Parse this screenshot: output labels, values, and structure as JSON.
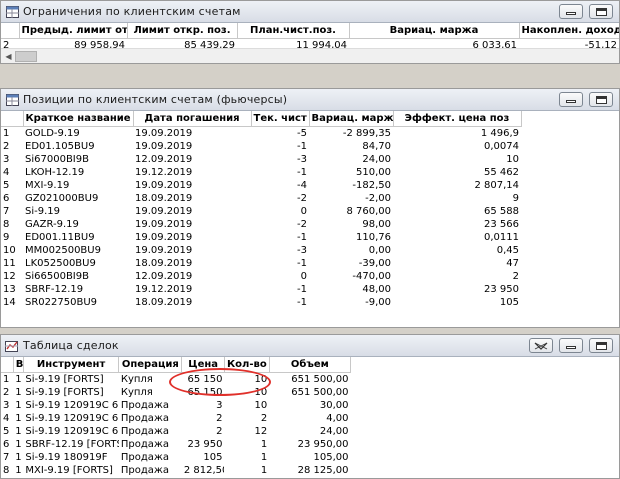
{
  "limits": {
    "title": "Ограничения по клиентским счетам",
    "columns": [
      "",
      "Предыд. лимит откр",
      "Лимит откр. поз.",
      "План.чист.поз.",
      "Вариац. маржа",
      "Накоплен. доход"
    ],
    "rows": [
      [
        "2",
        "89 958,94",
        "85 439,29",
        "11 994,04",
        "6 033,61",
        "-51,12"
      ]
    ]
  },
  "positions": {
    "title": "Позиции по клиентским счетам (фьючерсы)",
    "columns": [
      "",
      "Краткое название",
      "Дата погашения",
      "Тек. чист",
      "Вариац. маржа",
      "Эффект. цена поз"
    ],
    "rows": [
      [
        "1",
        "GOLD-9.19",
        "19.09.2019",
        "-5",
        "-2 899,35",
        "1 496,9"
      ],
      [
        "2",
        "ED01.105BU9",
        "19.09.2019",
        "-1",
        "84,70",
        "0,0074"
      ],
      [
        "3",
        "Si67000BI9B",
        "12.09.2019",
        "-3",
        "24,00",
        "10"
      ],
      [
        "4",
        "LKOH-12.19",
        "19.12.2019",
        "-1",
        "510,00",
        "55 462"
      ],
      [
        "5",
        "MXI-9.19",
        "19.09.2019",
        "-4",
        "-182,50",
        "2 807,14"
      ],
      [
        "6",
        "GZ021000BU9",
        "18.09.2019",
        "-2",
        "-2,00",
        "9"
      ],
      [
        "7",
        "Si-9.19",
        "19.09.2019",
        "0",
        "8 760,00",
        "65 588"
      ],
      [
        "8",
        "GAZR-9.19",
        "19.09.2019",
        "-2",
        "98,00",
        "23 566"
      ],
      [
        "9",
        "ED001.11BU9",
        "19.09.2019",
        "-1",
        "110,76",
        "0,0111"
      ],
      [
        "10",
        "MM002500BU9",
        "19.09.2019",
        "-3",
        "0,00",
        "0,45"
      ],
      [
        "11",
        "LK052500BU9",
        "18.09.2019",
        "-1",
        "-39,00",
        "47"
      ],
      [
        "12",
        "Si66500BI9B",
        "12.09.2019",
        "0",
        "-470,00",
        "2"
      ],
      [
        "13",
        "SBRF-12.19",
        "19.12.2019",
        "-1",
        "48,00",
        "23 950"
      ],
      [
        "14",
        "SR022750BU9",
        "18.09.2019",
        "-1",
        "-9,00",
        "105"
      ]
    ]
  },
  "deals": {
    "title": "Таблица сделок",
    "columns": [
      "",
      "В",
      "Инструмент",
      "Операция",
      "Цена",
      "Кол-во",
      "Объем"
    ],
    "rows": [
      [
        "1",
        "1",
        "Si-9.19 [FORTS]",
        "Купля",
        "65 150",
        "10",
        "651 500,00"
      ],
      [
        "2",
        "1",
        "Si-9.19 [FORTS]",
        "Купля",
        "65 150",
        "10",
        "651 500,00"
      ],
      [
        "3",
        "1",
        "Si-9.19   120919C 6",
        "Продажа",
        "3",
        "10",
        "30,00"
      ],
      [
        "4",
        "1",
        "Si-9.19   120919C 6",
        "Продажа",
        "2",
        "2",
        "4,00"
      ],
      [
        "5",
        "1",
        "Si-9.19   120919C 6",
        "Продажа",
        "2",
        "12",
        "24,00"
      ],
      [
        "6",
        "1",
        "SBRF-12.19 [FORTS",
        "Продажа",
        "23 950",
        "1",
        "23 950,00"
      ],
      [
        "7",
        "1",
        "Si-9.19   180919F",
        "Продажа",
        "105",
        "1",
        "105,00"
      ],
      [
        "8",
        "1",
        "MXI-9.19 [FORTS]",
        "Продажа",
        "2 812,50",
        "1",
        "28 125,00"
      ]
    ]
  },
  "colors": {
    "annotation": "#e0302a",
    "titlebar": "#d8dde6"
  },
  "icons": [
    "table-icon",
    "minimize-icon",
    "maximize-icon",
    "options-icon",
    "scroll-left-icon"
  ]
}
